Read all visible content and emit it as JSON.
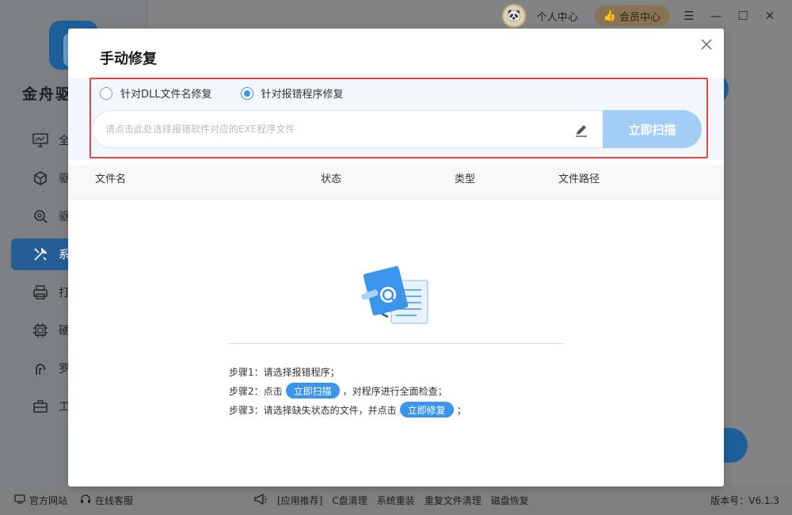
{
  "app": {
    "brand": "金舟驱",
    "sidebar": {
      "items": [
        {
          "label": "全",
          "icon": "monitor-icon"
        },
        {
          "label": "驱",
          "icon": "cube-gear-icon"
        },
        {
          "label": "驱",
          "icon": "gear-search-icon"
        },
        {
          "label": "系",
          "icon": "tools-icon",
          "active": true
        },
        {
          "label": "打",
          "icon": "printer-icon"
        },
        {
          "label": "硬",
          "icon": "chip-icon"
        },
        {
          "label": "罗",
          "icon": "horseshoe-icon"
        },
        {
          "label": "工",
          "icon": "toolbox-icon"
        }
      ]
    },
    "topbar": {
      "user_center": "个人中心",
      "vip_center": "会员中心"
    }
  },
  "footer": {
    "official_site": "官方网站",
    "online_service": "在线客服",
    "links": [
      "[应用推荐]",
      "C盘清理",
      "系统重装",
      "重复文件清理",
      "磁盘恢复"
    ],
    "version": "版本号：V6.1.3"
  },
  "modal": {
    "title": "手动修复",
    "modes": [
      {
        "label": "针对DLL文件名修复",
        "checked": false
      },
      {
        "label": "针对报错程序修复",
        "checked": true
      }
    ],
    "file_input_placeholder": "请点击此处选择报错软件对应的EXE程序文件",
    "scan_button": "立即扫描",
    "table_headers": {
      "name": "文件名",
      "status": "状态",
      "type": "类型",
      "path": "文件路径"
    },
    "steps": {
      "step1": "步骤1：请选择报错程序；",
      "step2_prefix": "步骤2：点击",
      "step2_button": "立即扫描",
      "step2_suffix": "，对程序进行全面检查；",
      "step3_prefix": "步骤3：请选择缺失状态的文件，并点击",
      "step3_button": "立即修复",
      "step3_suffix": "；"
    }
  },
  "colors": {
    "accent": "#3b95ec",
    "scan_disabled": "#a2cdf7",
    "highlight": "#e04848"
  }
}
